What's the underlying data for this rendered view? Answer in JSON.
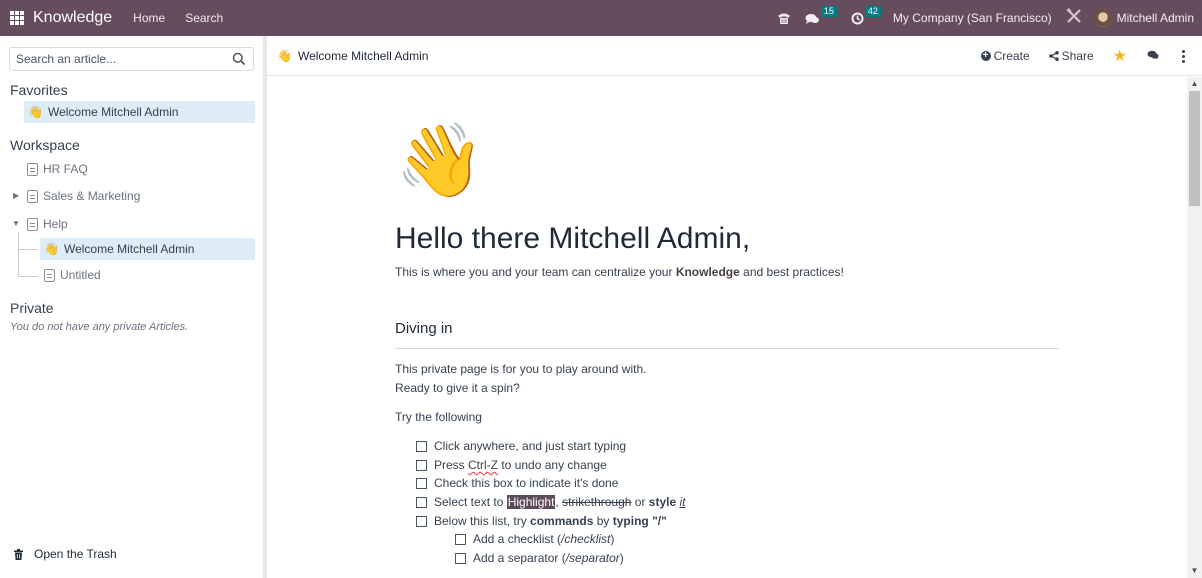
{
  "navbar": {
    "app_name": "Knowledge",
    "links": [
      "Home",
      "Search"
    ],
    "messages_count": "15",
    "activities_count": "42",
    "company": "My Company (San Francisco)",
    "user_name": "Mitchell Admin",
    "bg_color": "#664d5e",
    "badge_color": "#017e84"
  },
  "sidebar": {
    "search_placeholder": "Search an article...",
    "favorites_title": "Favorites",
    "favorites": [
      {
        "label": "Welcome Mitchell Admin",
        "icon": "waving-hand-icon",
        "active": true
      }
    ],
    "workspace_title": "Workspace",
    "workspace": [
      {
        "label": "HR FAQ",
        "icon": "document-icon"
      },
      {
        "label": "Sales & Marketing",
        "icon": "document-icon",
        "expandable": true,
        "expanded": false
      },
      {
        "label": "Help",
        "icon": "document-icon",
        "expandable": true,
        "expanded": true,
        "children": [
          {
            "label": "Welcome Mitchell Admin",
            "icon": "waving-hand-icon",
            "active": true
          },
          {
            "label": "Untitled",
            "icon": "document-icon"
          }
        ]
      }
    ],
    "private_title": "Private",
    "private_empty": "You do not have any private Articles.",
    "trash_label": "Open the Trash"
  },
  "header": {
    "article_title": "Welcome Mitchell Admin",
    "create_label": "Create",
    "share_label": "Share",
    "favorite_active": true
  },
  "article": {
    "emoji": "👋",
    "title": "Hello there Mitchell Admin,",
    "lead_before": "This is where you and your team can centralize your ",
    "lead_bold": "Knowledge",
    "lead_after": " and best practices!",
    "section_title": "Diving in",
    "p1": "This private page is for you to play around with.",
    "p2": "Ready to give it a spin?",
    "p3": "Try the following",
    "checklist": {
      "item1": "Click anywhere, and just start typing",
      "item2_before": "Press ",
      "item2_key": "Ctrl-Z",
      "item2_after": " to undo any change",
      "item3": "Check this box to indicate it's done",
      "item4_before": "Select text to ",
      "item4_highlight": "Highlight",
      "item4_sep": ", ",
      "item4_strike": "strikethrough",
      "item4_or": " or ",
      "item4_bold": "style",
      "item4_italic": "it",
      "item5_before": "Below this list, try ",
      "item5_bold1": "commands",
      "item5_mid": " by ",
      "item5_bold2": "typing",
      "item5_quote": " \"/\"",
      "sub1_before": "Add a checklist (",
      "sub1_cmd": "/checklist",
      "sub1_after": ")",
      "sub2_before": "Add a separator (",
      "sub2_cmd": "/separator",
      "sub2_after": ")"
    }
  }
}
